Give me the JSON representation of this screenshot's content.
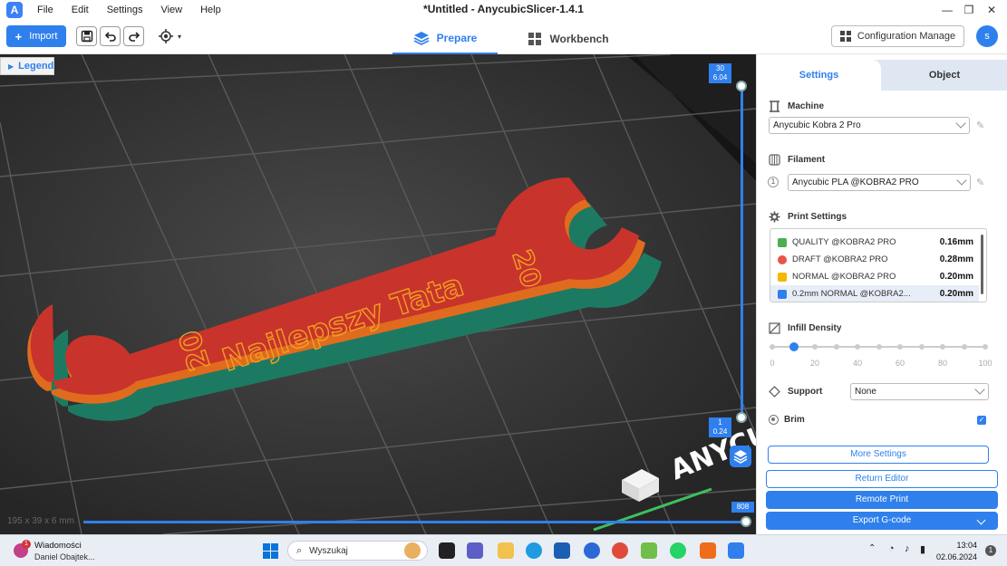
{
  "app": {
    "window_title": "*Untitled - AnycubicSlicer-1.4.1",
    "logo_letter": "A"
  },
  "menu": [
    "File",
    "Edit",
    "Settings",
    "View",
    "Help"
  ],
  "toolbar": {
    "import_label": "Import",
    "tabs": [
      {
        "label": "Prepare",
        "active": true
      },
      {
        "label": "Workbench",
        "active": false
      }
    ],
    "config_label": "Configuration Manage",
    "user_initial": "s"
  },
  "viewport": {
    "legend_label": "Legend",
    "model_text": "Najlepszy Tata",
    "model_number": "20",
    "brand_text": "ANYCU",
    "layer_top": {
      "layer": "30",
      "height": "6.04"
    },
    "layer_bottom": {
      "layer": "1",
      "height": "0.24"
    },
    "move_count": "808",
    "dimensions": "195 x 39 x 6 mm"
  },
  "panel": {
    "tabs": [
      {
        "label": "Settings",
        "active": true
      },
      {
        "label": "Object",
        "active": false
      }
    ],
    "machine": {
      "title": "Machine",
      "value": "Anycubic Kobra 2 Pro"
    },
    "filament": {
      "title": "Filament",
      "index": "1",
      "value": "Anycubic PLA @KOBRA2 PRO"
    },
    "print_settings": {
      "title": "Print Settings",
      "items": [
        {
          "name": "QUALITY @KOBRA2 PRO",
          "value": "0.16mm",
          "icon_color": "#4caf50"
        },
        {
          "name": "DRAFT @KOBRA2 PRO",
          "value": "0.28mm",
          "icon_color": "#e8534a"
        },
        {
          "name": "NORMAL @KOBRA2 PRO",
          "value": "0.20mm",
          "icon_color": "#f5b700"
        },
        {
          "name": "0.2mm NORMAL @KOBRA2...",
          "value": "0.20mm",
          "icon_color": "#2f80ed",
          "selected": true
        }
      ]
    },
    "infill": {
      "title": "Infill Density",
      "ticks": [
        "0",
        "20",
        "40",
        "60",
        "80",
        "100"
      ],
      "value_percent": 10
    },
    "support": {
      "title": "Support",
      "value": "None"
    },
    "brim": {
      "title": "Brim",
      "checked": true
    },
    "buttons": {
      "more_settings": "More Settings",
      "return_editor": "Return Editor",
      "remote_print": "Remote Print",
      "export_gcode": "Export G-code"
    }
  },
  "taskbar": {
    "notification_title": "Wiadomości",
    "notification_sub": "Daniel Obajtek...",
    "notification_badge": "1",
    "search_placeholder": "Wyszukaj",
    "time": "13:04",
    "date": "02.06.2024",
    "notif_count": "1"
  },
  "colors": {
    "accent": "#2f80ed",
    "model_red": "#c8332c",
    "model_orange": "#e06b1e",
    "model_teal": "#1d7a62",
    "bed_dark": "#303030"
  }
}
